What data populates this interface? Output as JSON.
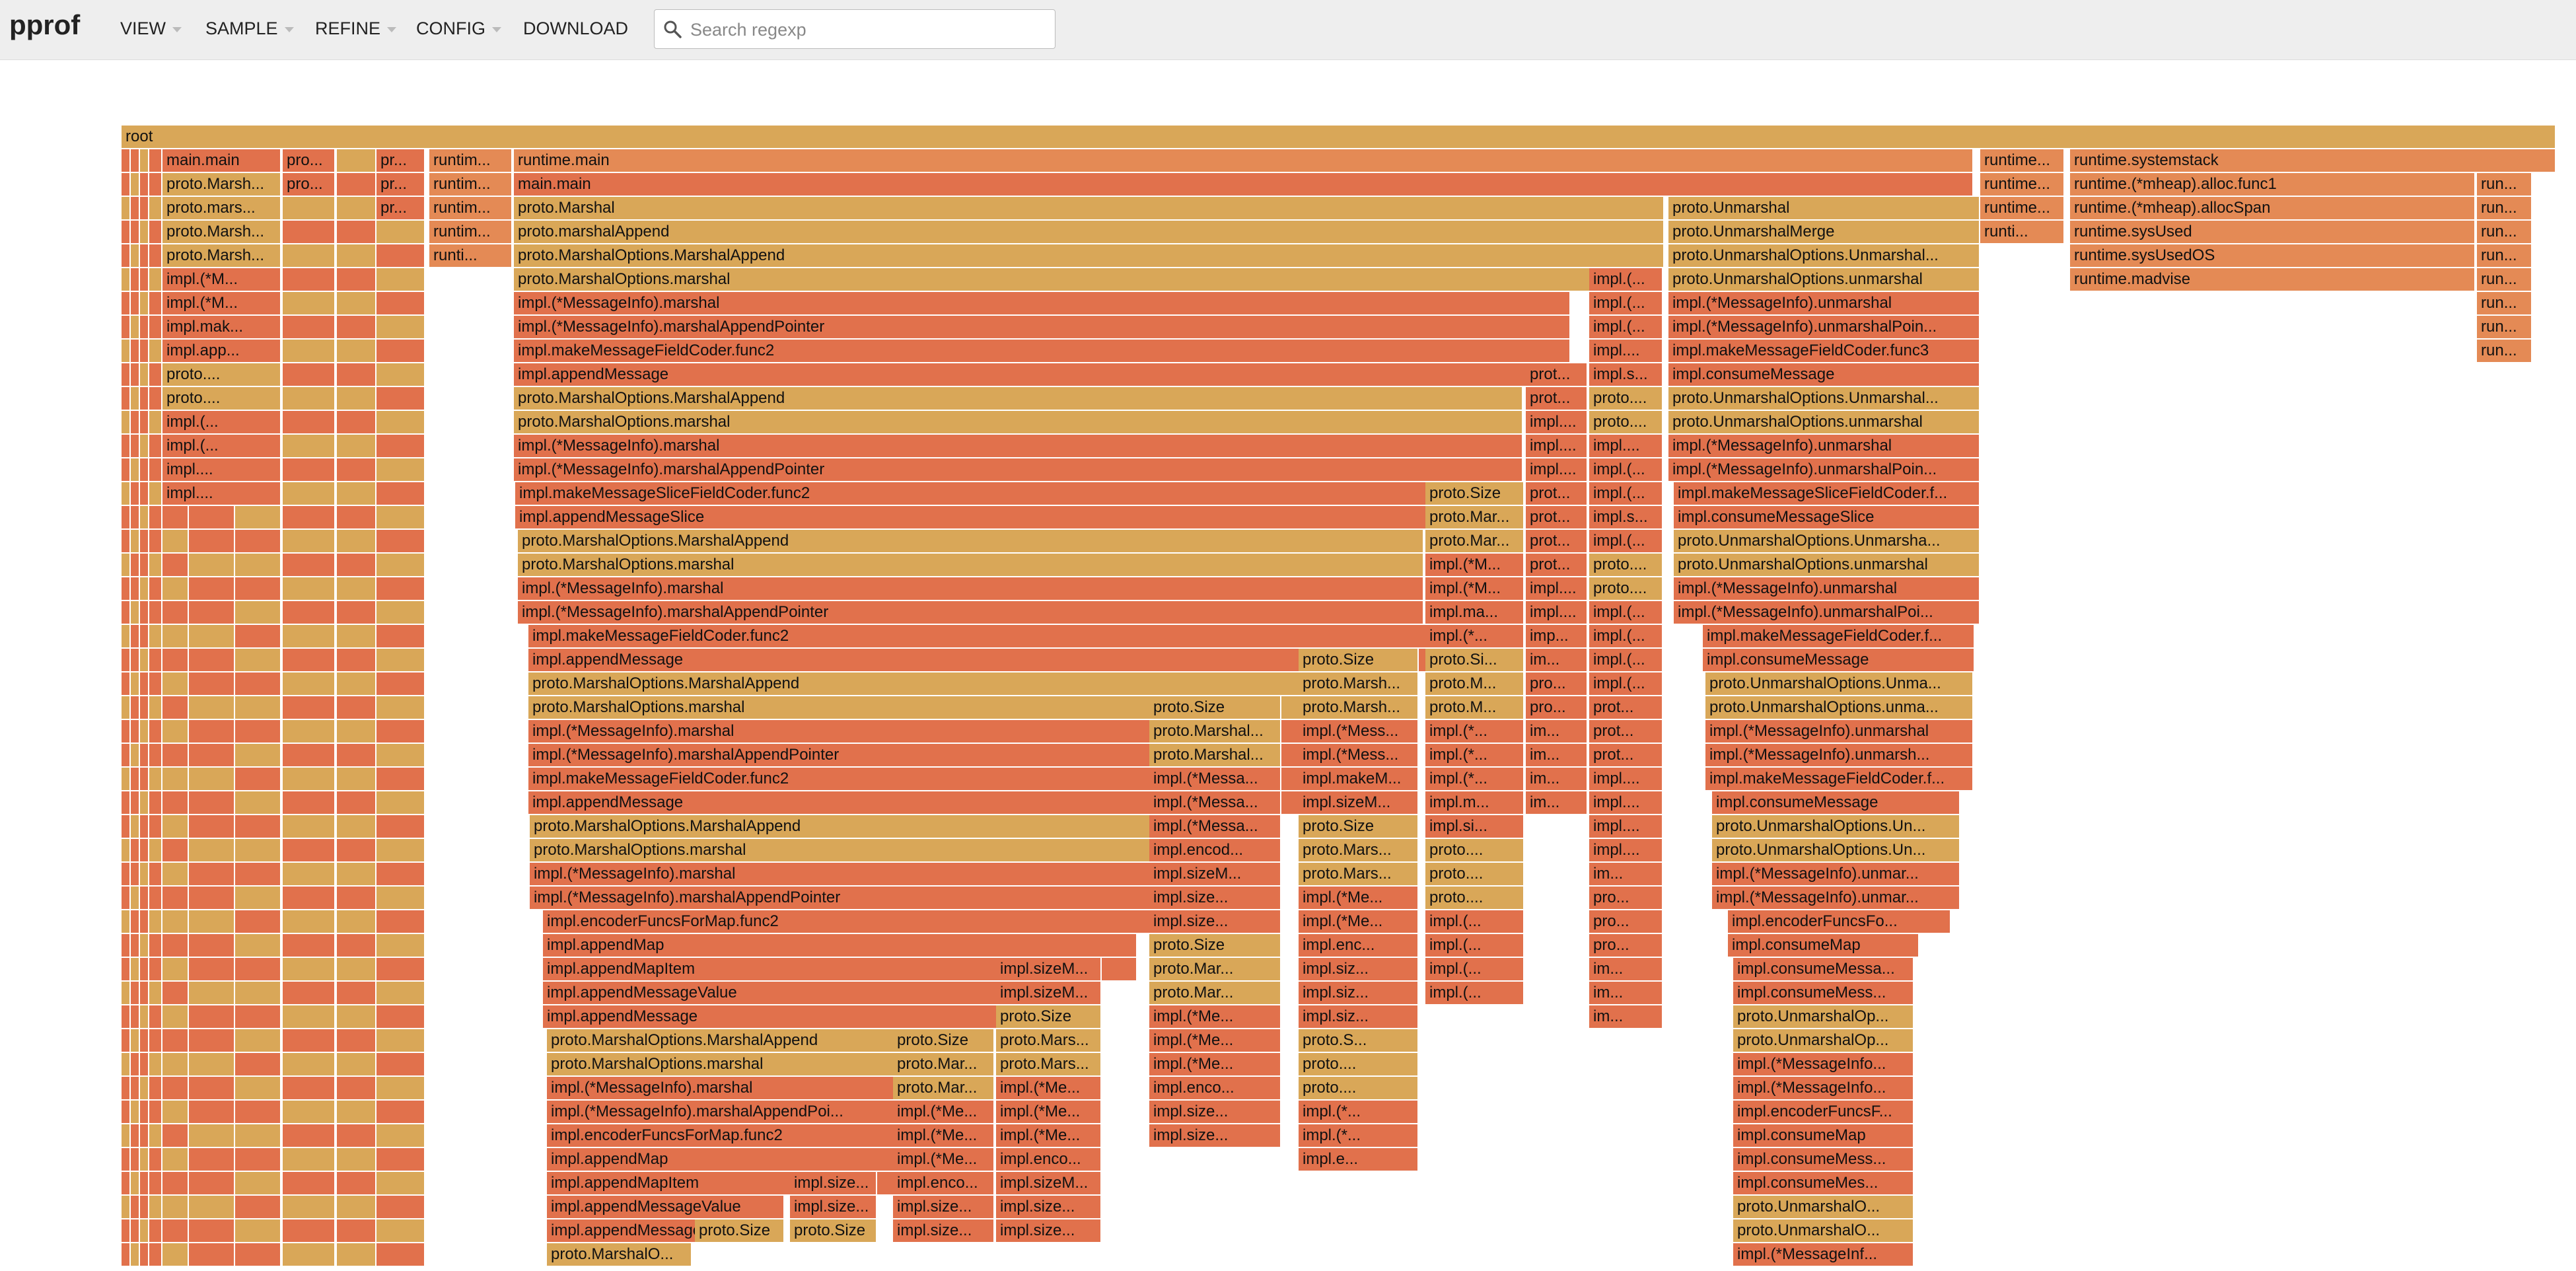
{
  "app": {
    "brand": "pprof",
    "menus": [
      "VIEW",
      "SAMPLE",
      "REFINE",
      "CONFIG",
      "DOWNLOAD"
    ],
    "search_placeholder": "Search regexp"
  },
  "colors": {
    "header_bg": "#eeeeee",
    "frame_red": "#e1714c",
    "frame_gold": "#d9a758",
    "frame_orange": "#e48a55"
  },
  "flame": {
    "root": "root",
    "left_columns": [
      [
        "main.main",
        "proto.Marsh...",
        "proto.mars...",
        "proto.Marsh...",
        "proto.Marsh...",
        "impl.(*M...",
        "impl.(*M...",
        "impl.mak...",
        "impl.app...",
        "proto....",
        "proto....",
        "impl.(...",
        "impl.(...",
        "impl....",
        "impl...."
      ],
      [
        "pro...",
        "pro..."
      ],
      [
        "pr...",
        "pr...",
        "pr..."
      ],
      [
        "runtim...",
        "runtim...",
        "runtim...",
        "runtim...",
        "runti..."
      ]
    ],
    "main_column": [
      "runtime.main",
      "main.main",
      "proto.Marshal",
      "proto.marshalAppend",
      "proto.MarshalOptions.MarshalAppend",
      "proto.MarshalOptions.marshal",
      "impl.(*MessageInfo).marshal",
      "impl.(*MessageInfo).marshalAppendPointer",
      "impl.makeMessageFieldCoder.func2",
      "impl.appendMessage",
      "proto.MarshalOptions.MarshalAppend",
      "proto.MarshalOptions.marshal",
      "impl.(*MessageInfo).marshal",
      "impl.(*MessageInfo).marshalAppendPointer",
      "impl.makeMessageSliceFieldCoder.func2",
      "impl.appendMessageSlice",
      "proto.MarshalOptions.MarshalAppend",
      "proto.MarshalOptions.marshal",
      "impl.(*MessageInfo).marshal",
      "impl.(*MessageInfo).marshalAppendPointer",
      "impl.makeMessageFieldCoder.func2",
      "impl.appendMessage",
      "proto.MarshalOptions.MarshalAppend",
      "proto.MarshalOptions.marshal",
      "impl.(*MessageInfo).marshal",
      "impl.(*MessageInfo).marshalAppendPointer",
      "impl.makeMessageFieldCoder.func2",
      "impl.appendMessage",
      "proto.MarshalOptions.MarshalAppend",
      "proto.MarshalOptions.marshal",
      "impl.(*MessageInfo).marshal",
      "impl.(*MessageInfo).marshalAppendPointer",
      "impl.encoderFuncsForMap.func2",
      "impl.appendMap",
      "impl.appendMapItem",
      "impl.appendMessageValue",
      "impl.appendMessage",
      "proto.MarshalOptions.MarshalAppend",
      "proto.MarshalOptions.marshal",
      "impl.(*MessageInfo).marshal",
      "impl.(*MessageInfo).marshalAppendPoi...",
      "impl.encoderFuncsForMap.func2",
      "impl.appendMap",
      "impl.appendMapItem",
      "impl.appendMessageValue",
      "impl.appendMessage",
      "proto.MarshalO..."
    ],
    "unmarshal_column": [
      "proto.Unmarshal",
      "proto.UnmarshalMerge",
      "proto.UnmarshalOptions.Unmarshal...",
      "proto.UnmarshalOptions.unmarshal",
      "impl.(*MessageInfo).unmarshal",
      "impl.(*MessageInfo).unmarshalPoin...",
      "impl.makeMessageFieldCoder.func3",
      "impl.consumeMessage",
      "proto.UnmarshalOptions.Unmarshal...",
      "proto.UnmarshalOptions.unmarshal",
      "impl.(*MessageInfo).unmarshal",
      "impl.(*MessageInfo).unmarshalPoin...",
      "impl.makeMessageSliceFieldCoder.f...",
      "impl.consumeMessageSlice",
      "proto.UnmarshalOptions.Unmarsha...",
      "proto.UnmarshalOptions.unmarshal",
      "impl.(*MessageInfo).unmarshal",
      "impl.(*MessageInfo).unmarshalPoi...",
      "impl.makeMessageFieldCoder.f...",
      "impl.consumeMessage",
      "proto.UnmarshalOptions.Unma...",
      "proto.UnmarshalOptions.unma...",
      "impl.(*MessageInfo).unmarshal",
      "impl.(*MessageInfo).unmarsh...",
      "impl.makeMessageFieldCoder.f...",
      "impl.consumeMessage",
      "proto.UnmarshalOptions.Un...",
      "proto.UnmarshalOptions.Un...",
      "impl.(*MessageInfo).unmar...",
      "impl.(*MessageInfo).unmar...",
      "impl.encoderFuncsFo...",
      "impl.consumeMap",
      "impl.consumeMessa...",
      "impl.consumeMess...",
      "proto.UnmarshalOp...",
      "proto.UnmarshalOp...",
      "impl.(*MessageInfo...",
      "impl.(*MessageInfo...",
      "impl.encoderFuncsF...",
      "impl.consumeMap",
      "impl.consumeMess...",
      "impl.consumeMes...",
      "proto.UnmarshalO...",
      "proto.UnmarshalO...",
      "impl.(*MessageInf..."
    ],
    "runtime_column": [
      "runtime...",
      "runtime...",
      "runtime...",
      "runti..."
    ],
    "systemstack_column": [
      "runtime.systemstack",
      "runtime.(*mheap).alloc.func1",
      "runtime.(*mheap).allocSpan",
      "runtime.sysUsed",
      "runtime.sysUsedOS",
      "runtime.madvise"
    ],
    "far_right_column": [
      "run...",
      "run...",
      "run...",
      "run...",
      "run...",
      "run...",
      "run...",
      "run..."
    ],
    "mid_columns": [
      [
        "impl.(...",
        "impl.(...",
        "impl.(...",
        "impl....",
        "impl.s...",
        "proto....",
        "proto....",
        "impl....",
        "impl.(...",
        "impl.(...",
        "impl.s...",
        "impl.(...",
        "proto....",
        "proto....",
        "impl.(...",
        "impl.(...",
        "impl.(...",
        "impl.(...",
        "prot...",
        "prot...",
        "prot...",
        "impl....",
        "impl....",
        "impl....",
        "impl....",
        "im...",
        "pro...",
        "pro...",
        "pro...",
        "im...",
        "im...",
        "im..."
      ],
      [
        "prot...",
        "prot...",
        "impl....",
        "impl....",
        "impl....",
        "prot...",
        "prot...",
        "prot...",
        "prot...",
        "impl....",
        "impl....",
        "imp...",
        "im...",
        "pro...",
        "pro...",
        "im...",
        "im...",
        "im...",
        "im..."
      ],
      [
        "proto.Size",
        "proto.Mar...",
        "proto.Mar...",
        "impl.(*M...",
        "impl.(*M...",
        "impl.ma...",
        "impl.(*...",
        "proto.Si...",
        "proto.M...",
        "proto.M...",
        "impl.(*...",
        "impl.(*...",
        "impl.(*...",
        "impl.m...",
        "impl.si...",
        "proto....",
        "proto....",
        "proto....",
        "impl.(...",
        "impl.(...",
        "impl.(...",
        "impl.(..."
      ],
      [
        "proto.Size",
        "proto.Marsh...",
        "proto.Marsh...",
        "impl.(*Mess...",
        "impl.(*Mess...",
        "impl.makeM...",
        "impl.sizeM...",
        "proto.Size",
        "proto.Mars...",
        "proto.Mars...",
        "impl.(*Me...",
        "impl.(*Me...",
        "impl.enc...",
        "impl.siz...",
        "impl.siz...",
        "impl.siz...",
        "proto.S...",
        "proto....",
        "proto....",
        "impl.(*...",
        "impl.(*...",
        "impl.e..."
      ],
      [
        "proto.Size",
        "proto.Marshal...",
        "proto.Marshal...",
        "impl.(*Messa...",
        "impl.(*Messa...",
        "impl.(*Messa...",
        "impl.encod...",
        "impl.sizeM...",
        "impl.size...",
        "impl.size...",
        "proto.Size",
        "proto.Mar...",
        "proto.Mar...",
        "impl.(*Me...",
        "impl.(*Me...",
        "impl.(*Me...",
        "impl.enco...",
        "impl.size...",
        "impl.size..."
      ]
    ],
    "deep_blocks": [
      [
        "impl.sizeM...",
        "impl.sizeM...",
        "proto.Size",
        "proto.Mars...",
        "proto.Mars...",
        "impl.(*Me...",
        "impl.(*Me...",
        "impl.(*Me...",
        "impl.enco...",
        "impl.sizeM...",
        "impl.size...",
        "impl.size..."
      ],
      [
        "proto.Size",
        "proto.Mar...",
        "proto.Mar...",
        "impl.(*Me...",
        "impl.(*Me...",
        "impl.(*Me...",
        "impl.enco...",
        "impl.size...",
        "impl.size..."
      ],
      [
        "impl.size...",
        "impl.size...",
        "proto.Size"
      ],
      [
        "proto.Size"
      ]
    ]
  }
}
